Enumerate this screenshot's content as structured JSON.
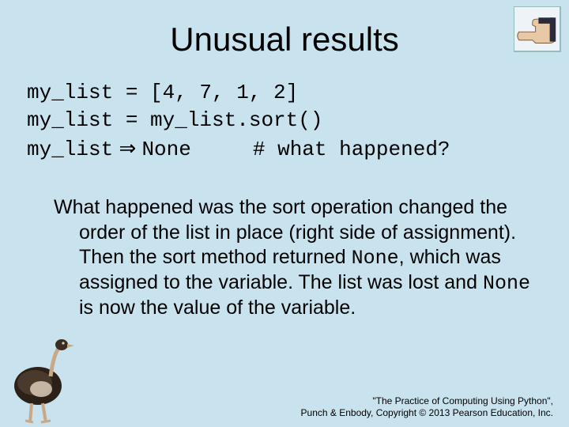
{
  "title": "Unusual results",
  "code": {
    "l1a": "my_list",
    "l1b": " = [4, 7, 1, 2]",
    "l2a": "my_list",
    "l2b": " = my_list.sort()",
    "l3a": "my_list",
    "arrow": " ⇒ ",
    "l3b": "None",
    "l3c": "     # what happened?"
  },
  "explain": {
    "p1": "What happened was the sort operation changed the order of the list in place (right side of assignment). Then the sort method returned ",
    "none1": "None",
    "p2": ", which was assigned to the variable. The list was lost and ",
    "none2": "None",
    "p3": " is now the value of the variable."
  },
  "footer": {
    "l1": "\"The Practice of Computing Using Python\",",
    "l2": "Punch & Enbody, Copyright © 2013 Pearson Education, Inc."
  }
}
